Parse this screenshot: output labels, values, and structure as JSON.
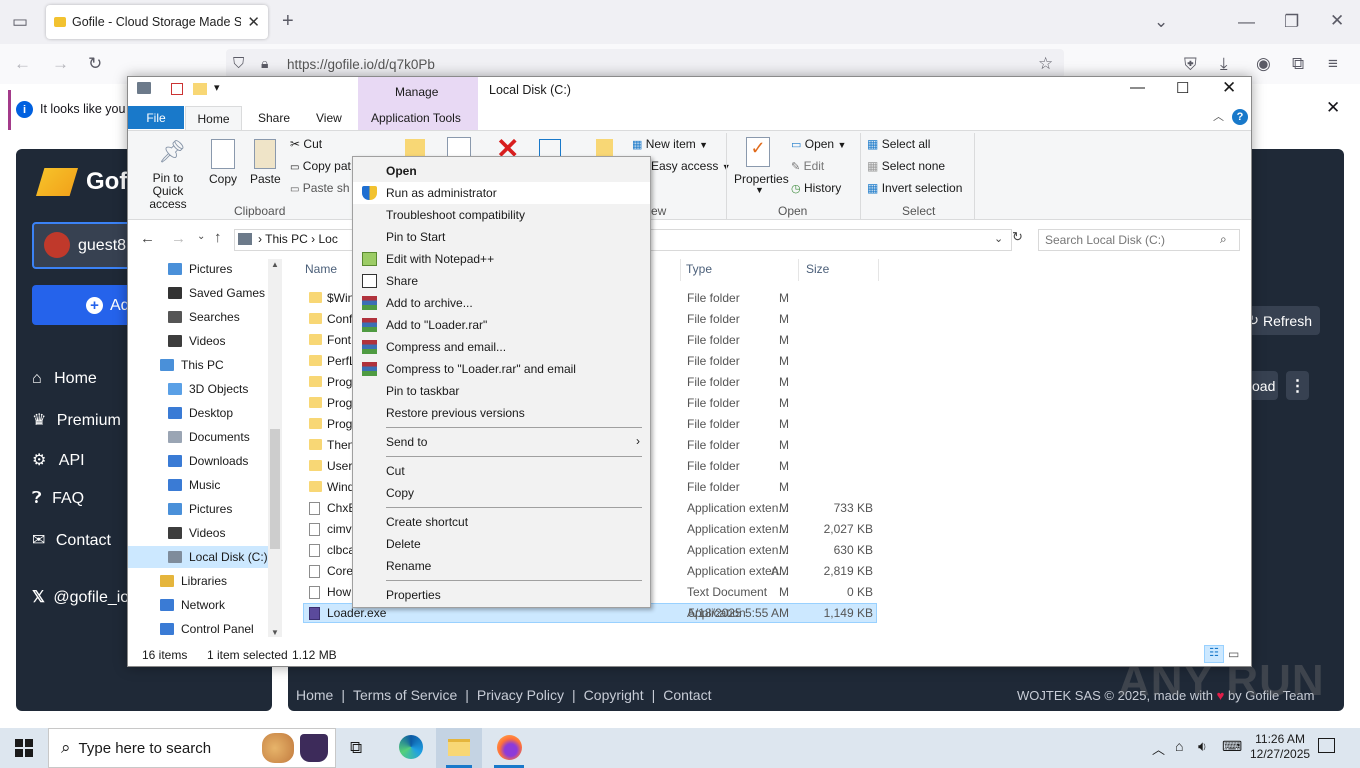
{
  "browser": {
    "tab_title": "Gofile - Cloud Storage Made Si",
    "url": "https://gofile.io/d/q7k0Pb",
    "notification": "It looks like you"
  },
  "site": {
    "logo_text": "Gofi",
    "user_label": "guest8",
    "add_button": "Ad",
    "nav": [
      {
        "label": "Home",
        "icon": "home-icon"
      },
      {
        "label": "Premium",
        "icon": "crown-icon"
      },
      {
        "label": "API",
        "icon": "gears-icon"
      },
      {
        "label": "FAQ",
        "icon": "question-icon"
      },
      {
        "label": "Contact",
        "icon": "envelope-icon"
      }
    ],
    "social": "@gofile_io",
    "refresh_button": "Refresh",
    "download_button_partial": "oad",
    "footer_links": [
      "Home",
      "Terms of Service",
      "Privacy Policy",
      "Copyright",
      "Contact"
    ],
    "footer_credit": "WOJTEK SAS © 2025, made with",
    "footer_team": "by Gofile Team",
    "watermark": "ANY RUN"
  },
  "explorer": {
    "title": "Local Disk (C:)",
    "manage_tab": "Manage",
    "tabs": {
      "file": "File",
      "home": "Home",
      "share": "Share",
      "view": "View",
      "app_tools": "Application Tools"
    },
    "ribbon": {
      "pin": "Pin to Quick access",
      "copy": "Copy",
      "paste": "Paste",
      "cut": "Cut",
      "copy_path": "Copy pat",
      "paste_shortcut": "Paste sh",
      "clipboard_group": "Clipboard",
      "new_item": "New item",
      "easy_access": "Easy access",
      "new_group_partial": "ew",
      "properties": "Properties",
      "open": "Open",
      "edit": "Edit",
      "history": "History",
      "open_group": "Open",
      "select_all": "Select all",
      "select_none": "Select none",
      "invert_selection": "Invert selection",
      "select_group": "Select"
    },
    "address": {
      "this_pc": "This PC",
      "crumb": "Loc"
    },
    "search_placeholder": "Search Local Disk (C:)",
    "nav_pane": [
      {
        "label": "Pictures",
        "indent": 2
      },
      {
        "label": "Saved Games",
        "indent": 2
      },
      {
        "label": "Searches",
        "indent": 2
      },
      {
        "label": "Videos",
        "indent": 2
      },
      {
        "label": "This PC",
        "indent": 1
      },
      {
        "label": "3D Objects",
        "indent": 2
      },
      {
        "label": "Desktop",
        "indent": 2
      },
      {
        "label": "Documents",
        "indent": 2
      },
      {
        "label": "Downloads",
        "indent": 2
      },
      {
        "label": "Music",
        "indent": 2
      },
      {
        "label": "Pictures",
        "indent": 2
      },
      {
        "label": "Videos",
        "indent": 2
      },
      {
        "label": "Local Disk (C:)",
        "indent": 2
      },
      {
        "label": "Libraries",
        "indent": 1
      },
      {
        "label": "Network",
        "indent": 1
      },
      {
        "label": "Control Panel",
        "indent": 1
      }
    ],
    "columns": {
      "name": "Name",
      "type": "Type",
      "size": "Size"
    },
    "files": [
      {
        "name": "$Win",
        "date": "M",
        "type": "File folder",
        "size": "",
        "kind": "folder"
      },
      {
        "name": "Conf",
        "date": "M",
        "type": "File folder",
        "size": "",
        "kind": "folder"
      },
      {
        "name": "Font",
        "date": "M",
        "type": "File folder",
        "size": "",
        "kind": "folder"
      },
      {
        "name": "PerfL",
        "date": "M",
        "type": "File folder",
        "size": "",
        "kind": "folder"
      },
      {
        "name": "Prog",
        "date": "M",
        "type": "File folder",
        "size": "",
        "kind": "folder"
      },
      {
        "name": "Prog",
        "date": "M",
        "type": "File folder",
        "size": "",
        "kind": "folder"
      },
      {
        "name": "Prog",
        "date": "M",
        "type": "File folder",
        "size": "",
        "kind": "folder"
      },
      {
        "name": "Then",
        "date": "M",
        "type": "File folder",
        "size": "",
        "kind": "folder"
      },
      {
        "name": "Users",
        "date": "M",
        "type": "File folder",
        "size": "",
        "kind": "folder"
      },
      {
        "name": "Wind",
        "date": "M",
        "type": "File folder",
        "size": "",
        "kind": "folder"
      },
      {
        "name": "ChxE",
        "date": "M",
        "type": "Application exten...",
        "size": "733 KB",
        "kind": "file"
      },
      {
        "name": "cimv",
        "date": "M",
        "type": "Application exten...",
        "size": "2,027 KB",
        "kind": "file"
      },
      {
        "name": "clbca",
        "date": "M",
        "type": "Application exten...",
        "size": "630 KB",
        "kind": "file"
      },
      {
        "name": "Core",
        "date": "AM",
        "type": "Application exten...",
        "size": "2,819 KB",
        "kind": "file"
      },
      {
        "name": "How",
        "date": "M",
        "type": "Text Document",
        "size": "0 KB",
        "kind": "file"
      },
      {
        "name": "Loader.exe",
        "date": "5/18/2025 5:55 AM",
        "type": "Application",
        "size": "1,149 KB",
        "kind": "app"
      }
    ],
    "status": {
      "count": "16 items",
      "selected": "1 item selected",
      "size": "1.12 MB"
    }
  },
  "context_menu": {
    "items": [
      {
        "label": "Open",
        "bold": true,
        "icon": ""
      },
      {
        "label": "Run as administrator",
        "icon": "shield-icon",
        "highlight": true
      },
      {
        "label": "Troubleshoot compatibility",
        "icon": ""
      },
      {
        "label": "Pin to Start",
        "icon": ""
      },
      {
        "label": "Edit with Notepad++",
        "icon": "notepad-icon"
      },
      {
        "label": "Share",
        "icon": "share-icon"
      },
      {
        "label": "Add to archive...",
        "icon": "winrar-icon"
      },
      {
        "label": "Add to \"Loader.rar\"",
        "icon": "winrar-icon"
      },
      {
        "label": "Compress and email...",
        "icon": "winrar-icon"
      },
      {
        "label": "Compress to \"Loader.rar\" and email",
        "icon": "winrar-icon"
      },
      {
        "label": "Pin to taskbar",
        "icon": ""
      },
      {
        "label": "Restore previous versions",
        "icon": ""
      },
      {
        "label": "Send to",
        "icon": "",
        "submenu": true
      },
      {
        "label": "Cut",
        "icon": ""
      },
      {
        "label": "Copy",
        "icon": ""
      },
      {
        "label": "Create shortcut",
        "icon": ""
      },
      {
        "label": "Delete",
        "icon": ""
      },
      {
        "label": "Rename",
        "icon": ""
      },
      {
        "label": "Properties",
        "icon": ""
      }
    ]
  },
  "taskbar": {
    "search_placeholder": "Type here to search",
    "time": "11:26 AM",
    "date": "12/27/2025"
  },
  "colors": {
    "accent_blue": "#1979ca",
    "site_panel": "#1f2937",
    "selection": "#cce8ff",
    "manage_tab": "#e8d9f4"
  }
}
